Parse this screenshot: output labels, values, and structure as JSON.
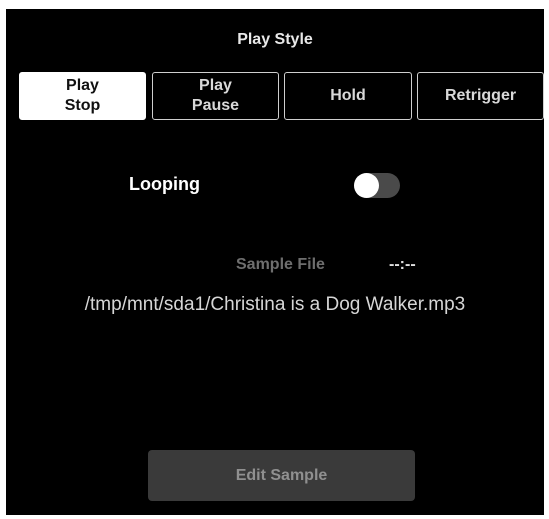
{
  "play_style": {
    "title": "Play Style",
    "options": [
      {
        "label": "Play\nStop",
        "selected": true
      },
      {
        "label": "Play\nPause",
        "selected": false
      },
      {
        "label": "Hold",
        "selected": false
      },
      {
        "label": "Retrigger",
        "selected": false
      }
    ]
  },
  "looping": {
    "label": "Looping",
    "enabled": false
  },
  "sample": {
    "label": "Sample File",
    "duration": "--:--",
    "path": "/tmp/mnt/sda1/Christina is a Dog Walker.mp3"
  },
  "edit_button": {
    "label": "Edit Sample"
  },
  "colors": {
    "background": "#000000",
    "selected_button": "#ffffff",
    "button_border": "#cfcfcf",
    "toggle_track_off": "#4a4a4a",
    "edit_button_bg": "#3a3a3a",
    "muted_text": "#6e6e6e"
  }
}
